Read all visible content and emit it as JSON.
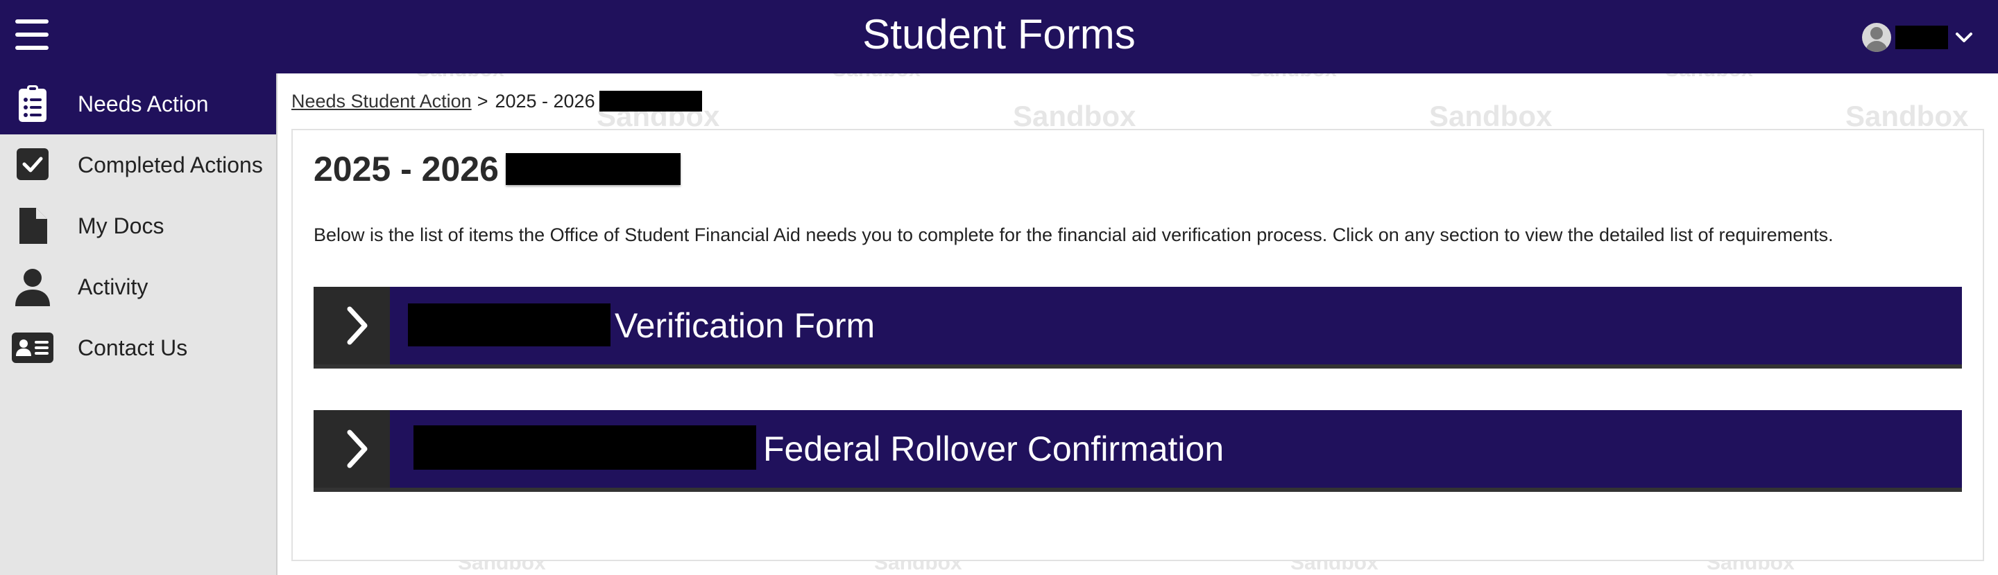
{
  "header": {
    "title": "Student Forms"
  },
  "sidebar": {
    "items": [
      {
        "label": "Needs Action"
      },
      {
        "label": "Completed Actions"
      },
      {
        "label": "My Docs"
      },
      {
        "label": "Activity"
      },
      {
        "label": "Contact Us"
      }
    ]
  },
  "breadcrumb": {
    "link": "Needs Student Action",
    "separator": ">",
    "current": "2025 - 2026"
  },
  "watermark": {
    "text": "Sandbox"
  },
  "content": {
    "title": "2025 - 2026",
    "intro": "Below is the list of items the Office of Student Financial Aid needs you to complete for the financial aid verification process. Click on any section to view the detailed list of requirements.",
    "sections": [
      {
        "label": "Verification Form"
      },
      {
        "label": "Federal Rollover Confirmation"
      }
    ]
  },
  "colors": {
    "brand": "#20115c",
    "toggle_bg": "#2a2a2a",
    "sidebar_bg": "#e5e5e5"
  }
}
